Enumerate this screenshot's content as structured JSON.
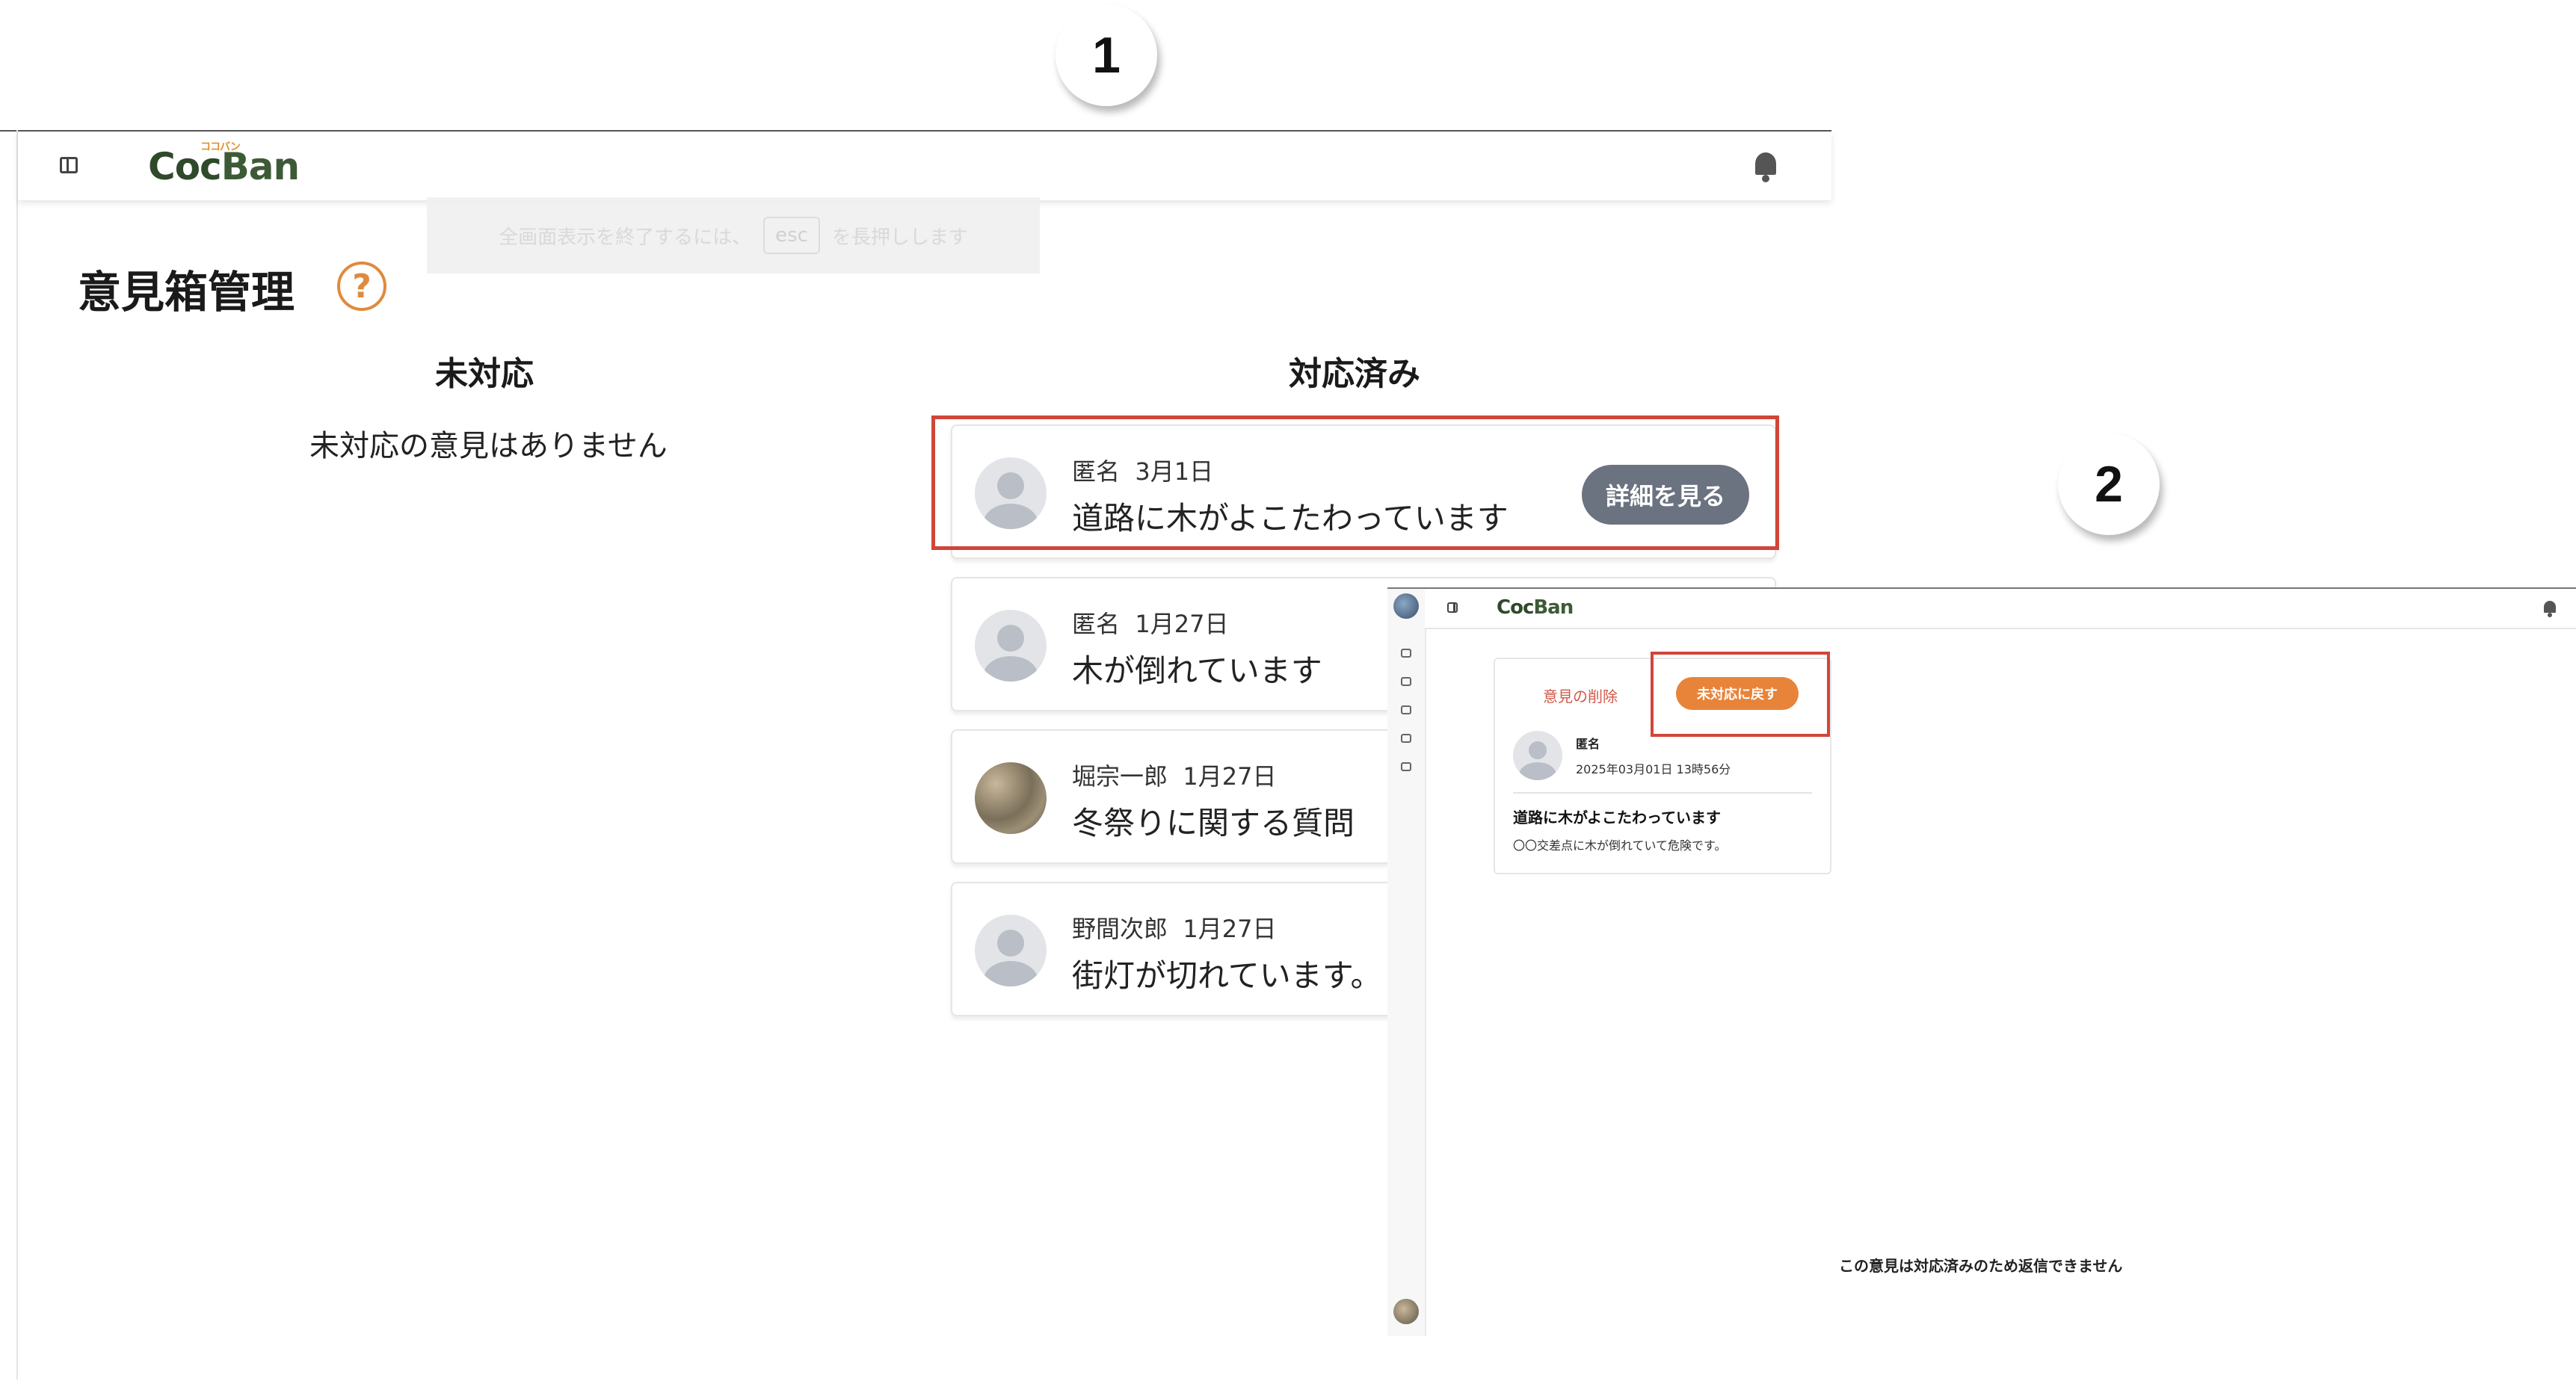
{
  "steps": [
    "1",
    "2"
  ],
  "app": {
    "logo_text": "Coc",
    "logo_b": "Ban",
    "logo_kana": "ココバン"
  },
  "fullscreen_hint": {
    "before": "全画面表示を終了するには、",
    "key": "esc",
    "after": "を長押しします"
  },
  "page": {
    "title": "意見箱管理",
    "help_symbol": "?"
  },
  "columns": {
    "pending_title": "未対応",
    "pending_empty": "未対応の意見はありません",
    "done_title": "対応済み"
  },
  "cards": [
    {
      "author": "匿名",
      "date": "3月1日",
      "subject": "道路に木がよこたわっています",
      "button": "詳細を見る"
    },
    {
      "author": "匿名",
      "date": "1月27日",
      "subject": "木が倒れています"
    },
    {
      "author": "堀宗一郎",
      "date": "1月27日",
      "subject": "冬祭りに関する質問"
    },
    {
      "author": "野間次郎",
      "date": "1月27日",
      "subject": "街灯が切れています。"
    }
  ],
  "detail": {
    "delete_label": "意見の削除",
    "revert_label": "未対応に戻す",
    "author": "匿名",
    "datetime": "2025年03月01日 13時56分",
    "subject": "道路に木がよこたわっています",
    "body": "〇〇交差点に木が倒れていて危険です。",
    "no_reply_notice": "この意見は対応済みのため返信できません"
  },
  "colors": {
    "accent_orange": "#e8843a",
    "highlight_red": "#d0463a",
    "button_gray": "#6b7280"
  }
}
